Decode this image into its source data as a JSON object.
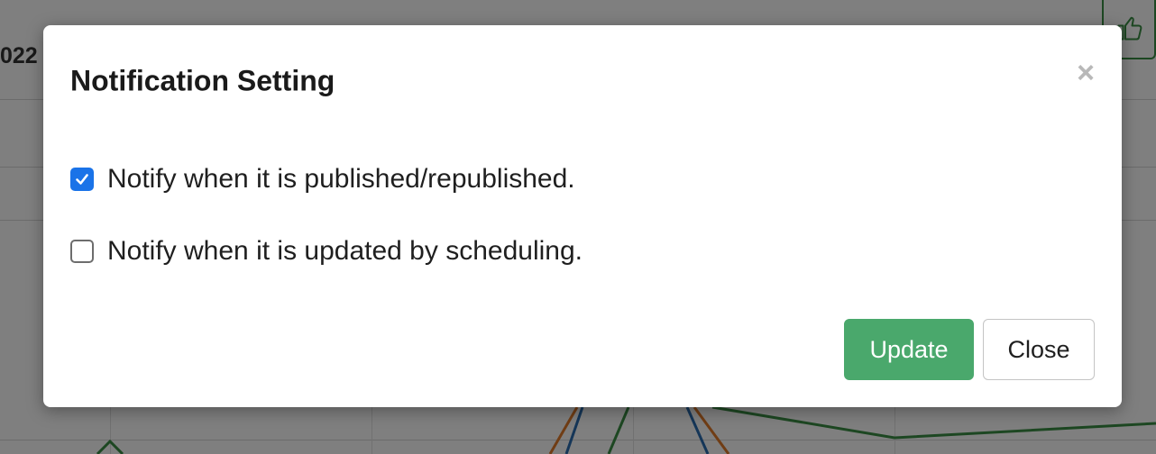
{
  "background": {
    "year_fragment": "022",
    "like_icon": "thumbs-up-icon"
  },
  "modal": {
    "title": "Notification Setting",
    "close_icon": "close-icon",
    "close_glyph": "×",
    "options": [
      {
        "label": "Notify when it is published/republished.",
        "checked": true
      },
      {
        "label": "Notify when it is updated by scheduling.",
        "checked": false
      }
    ],
    "buttons": {
      "update_label": "Update",
      "close_label": "Close"
    }
  },
  "colors": {
    "update_button": "#4aa86c",
    "checkbox_checked": "#1a73e8"
  }
}
